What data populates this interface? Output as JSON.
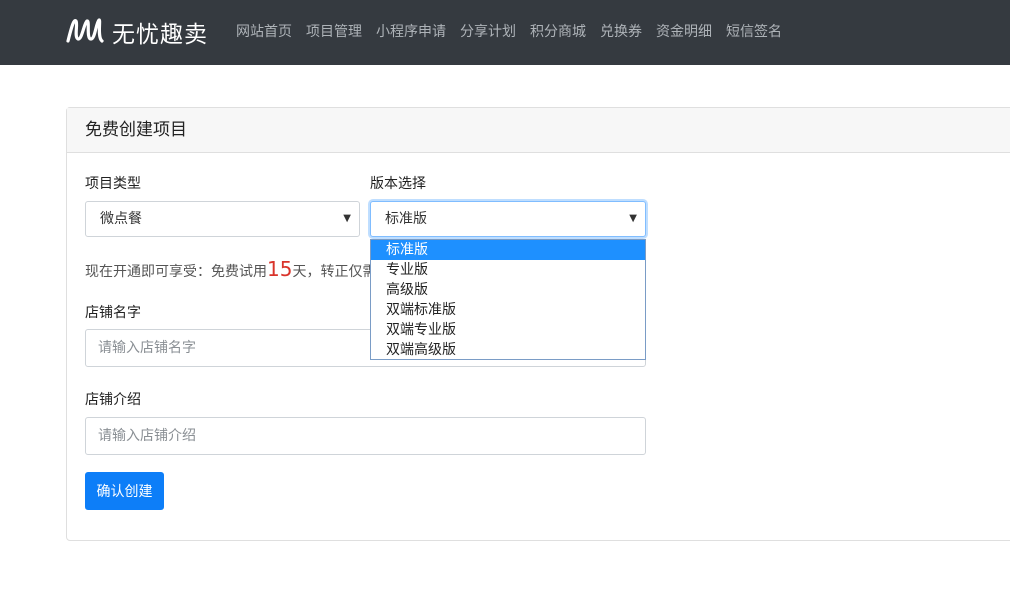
{
  "nav": {
    "brand": "无忧趣卖",
    "links": [
      "网站首页",
      "项目管理",
      "小程序申请",
      "分享计划",
      "积分商城",
      "兑换券",
      "资金明细",
      "短信签名"
    ]
  },
  "card": {
    "title": "免费创建项目",
    "project_type": {
      "label": "项目类型",
      "value": "微点餐"
    },
    "version": {
      "label": "版本选择",
      "value": "标准版",
      "options": [
        "标准版",
        "专业版",
        "高级版",
        "双端标准版",
        "双端专业版",
        "双端高级版"
      ],
      "selected_index": 0
    },
    "promo": {
      "prefix": "现在开通即可享受：免费试用",
      "days": "15",
      "suffix": "天，转正仅需"
    },
    "shop_name": {
      "label": "店铺名字",
      "placeholder": "请输入店铺名字"
    },
    "shop_intro": {
      "label": "店铺介绍",
      "placeholder": "请输入店铺介绍"
    },
    "submit_label": "确认创建"
  },
  "colors": {
    "navbar": "#353a40",
    "primary": "#0d7ef8",
    "highlight": "#d9342b",
    "dropdown_selected": "#1e90ff"
  }
}
